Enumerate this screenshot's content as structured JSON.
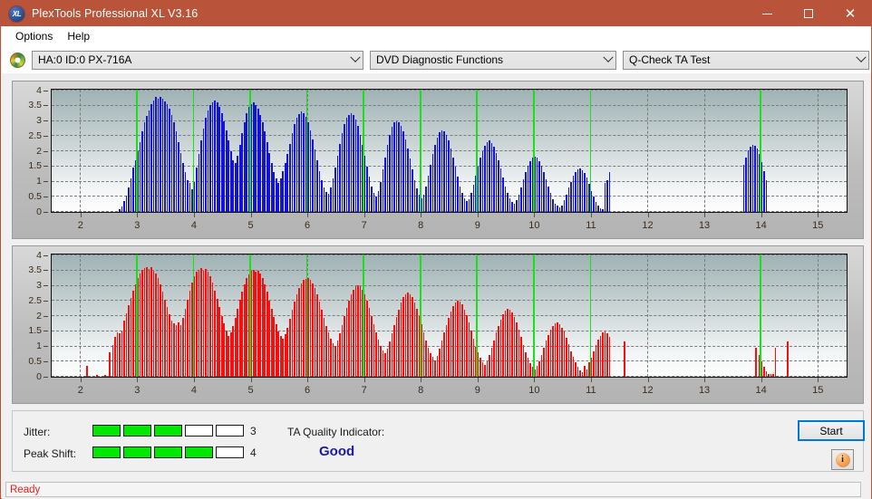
{
  "window": {
    "title": "PlexTools Professional XL V3.16",
    "app_icon": "XL",
    "minimize_label": "Minimize",
    "maximize_label": "Maximize",
    "close_label": "Close",
    "titlebar_color": "#b9543a"
  },
  "menu": {
    "items": [
      {
        "label": "Options"
      },
      {
        "label": "Help"
      }
    ]
  },
  "toolbar": {
    "device_icon": "disc-icon",
    "device": {
      "value": "HA:0 ID:0  PX-716A"
    },
    "function": {
      "value": "DVD Diagnostic Functions"
    },
    "test": {
      "value": "Q-Check TA Test"
    }
  },
  "indicators": {
    "jitter_label": "Jitter:",
    "jitter_value": "3",
    "jitter_filled": 3,
    "jitter_total": 5,
    "peak_shift_label": "Peak Shift:",
    "peak_shift_value": "4",
    "peak_shift_filled": 4,
    "peak_shift_total": 5,
    "quality_label": "TA Quality Indicator:",
    "quality_value": "Good",
    "quality_color": "#1a1aa8",
    "meter_on_color": "#00e700",
    "start_label": "Start",
    "info_icon": "info-icon",
    "info_glyph": "i"
  },
  "statusbar": {
    "text": "Ready",
    "color": "#e02020"
  },
  "chart_data": [
    {
      "id": "chart-top",
      "type": "bar",
      "title": "",
      "xlabel": "",
      "ylabel": "",
      "series_name": "Jitter / TA deviation (top)",
      "color": "#1313d8",
      "xlim": [
        1.5,
        15.5
      ],
      "ylim": [
        0,
        4
      ],
      "xticks": [
        2,
        3,
        4,
        5,
        6,
        7,
        8,
        9,
        10,
        11,
        12,
        13,
        14,
        15
      ],
      "yticks": [
        0,
        0.5,
        1,
        1.5,
        2,
        2.5,
        3,
        3.5,
        4
      ],
      "ytick_labels": [
        "0",
        "0.5",
        "1",
        "1.5",
        "2",
        "2.5",
        "3",
        "3.5",
        "4"
      ],
      "grid": true,
      "markers": [
        3,
        4,
        5,
        6,
        7,
        8,
        9,
        10,
        11,
        14
      ],
      "bar_width": 0.016,
      "x": [
        2.7,
        2.74,
        2.78,
        2.82,
        2.86,
        2.9,
        2.94,
        2.98,
        3.02,
        3.06,
        3.1,
        3.14,
        3.18,
        3.22,
        3.26,
        3.3,
        3.34,
        3.38,
        3.42,
        3.46,
        3.5,
        3.54,
        3.58,
        3.62,
        3.66,
        3.7,
        3.74,
        3.78,
        3.82,
        3.86,
        3.9,
        3.94,
        3.98,
        4.02,
        4.06,
        4.1,
        4.14,
        4.18,
        4.22,
        4.26,
        4.3,
        4.34,
        4.38,
        4.42,
        4.46,
        4.5,
        4.54,
        4.58,
        4.62,
        4.66,
        4.7,
        4.74,
        4.78,
        4.82,
        4.86,
        4.9,
        4.94,
        4.98,
        5.02,
        5.06,
        5.1,
        5.14,
        5.18,
        5.22,
        5.26,
        5.3,
        5.34,
        5.38,
        5.42,
        5.46,
        5.5,
        5.54,
        5.58,
        5.62,
        5.66,
        5.7,
        5.74,
        5.78,
        5.82,
        5.86,
        5.9,
        5.94,
        5.98,
        6.02,
        6.06,
        6.1,
        6.14,
        6.18,
        6.22,
        6.26,
        6.3,
        6.34,
        6.38,
        6.42,
        6.46,
        6.5,
        6.54,
        6.58,
        6.62,
        6.66,
        6.7,
        6.74,
        6.78,
        6.82,
        6.86,
        6.9,
        6.94,
        6.98,
        7.02,
        7.06,
        7.1,
        7.14,
        7.18,
        7.22,
        7.26,
        7.3,
        7.34,
        7.38,
        7.42,
        7.46,
        7.5,
        7.54,
        7.58,
        7.62,
        7.66,
        7.7,
        7.74,
        7.78,
        7.82,
        7.86,
        7.9,
        7.94,
        7.98,
        8.02,
        8.06,
        8.1,
        8.14,
        8.18,
        8.22,
        8.26,
        8.3,
        8.34,
        8.38,
        8.42,
        8.46,
        8.5,
        8.54,
        8.58,
        8.62,
        8.66,
        8.7,
        8.74,
        8.78,
        8.82,
        8.86,
        8.9,
        8.94,
        8.98,
        9.02,
        9.06,
        9.1,
        9.14,
        9.18,
        9.22,
        9.26,
        9.3,
        9.34,
        9.38,
        9.42,
        9.46,
        9.5,
        9.54,
        9.58,
        9.62,
        9.66,
        9.7,
        9.74,
        9.78,
        9.82,
        9.86,
        9.9,
        9.94,
        9.98,
        10.02,
        10.06,
        10.1,
        10.14,
        10.18,
        10.22,
        10.26,
        10.3,
        10.34,
        10.38,
        10.42,
        10.46,
        10.5,
        10.54,
        10.58,
        10.62,
        10.66,
        10.7,
        10.74,
        10.78,
        10.82,
        10.86,
        10.9,
        10.94,
        10.98,
        11.02,
        11.06,
        11.1,
        11.14,
        11.18,
        11.22,
        11.26,
        11.3,
        11.34,
        13.7,
        13.74,
        13.78,
        13.82,
        13.86,
        13.9,
        13.94,
        13.98,
        14.02,
        14.06,
        14.1,
        14.14,
        14.18,
        14.22
      ],
      "values": [
        0.1,
        0.18,
        0.35,
        0.55,
        0.8,
        1.1,
        1.45,
        1.7,
        2.0,
        2.3,
        2.65,
        2.95,
        3.15,
        3.35,
        3.55,
        3.68,
        3.78,
        3.72,
        3.8,
        3.72,
        3.65,
        3.55,
        3.4,
        3.2,
        2.95,
        2.65,
        2.3,
        1.95,
        1.6,
        1.3,
        1.05,
        0.95,
        0.75,
        1.0,
        1.45,
        1.9,
        2.35,
        2.75,
        3.1,
        3.35,
        3.52,
        3.62,
        3.68,
        3.6,
        3.45,
        3.25,
        3.0,
        2.7,
        2.35,
        2.0,
        1.7,
        1.6,
        1.85,
        2.2,
        2.6,
        2.95,
        3.25,
        3.45,
        3.55,
        3.6,
        3.52,
        3.4,
        3.2,
        2.95,
        2.65,
        2.3,
        1.95,
        1.6,
        1.3,
        1.1,
        0.95,
        1.1,
        1.35,
        1.6,
        1.9,
        2.25,
        2.6,
        2.9,
        3.1,
        3.22,
        3.3,
        3.25,
        3.12,
        2.95,
        2.7,
        2.4,
        2.05,
        1.7,
        1.35,
        1.05,
        0.8,
        0.65,
        0.6,
        0.8,
        1.1,
        1.45,
        1.85,
        2.25,
        2.6,
        2.9,
        3.1,
        3.2,
        3.25,
        3.18,
        3.05,
        2.85,
        2.55,
        2.2,
        1.85,
        1.5,
        1.15,
        0.85,
        0.62,
        0.5,
        0.68,
        1.0,
        1.4,
        1.8,
        2.2,
        2.55,
        2.8,
        2.95,
        3.0,
        2.95,
        2.85,
        2.65,
        2.4,
        2.1,
        1.75,
        1.4,
        1.05,
        0.78,
        0.58,
        0.45,
        0.58,
        0.85,
        1.2,
        1.55,
        1.9,
        2.2,
        2.45,
        2.62,
        2.7,
        2.65,
        2.55,
        2.35,
        2.1,
        1.8,
        1.48,
        1.15,
        0.85,
        0.62,
        0.45,
        0.35,
        0.42,
        0.62,
        0.9,
        1.2,
        1.5,
        1.78,
        2.0,
        2.18,
        2.3,
        2.35,
        2.28,
        2.15,
        1.95,
        1.7,
        1.42,
        1.12,
        0.85,
        0.62,
        0.45,
        0.32,
        0.28,
        0.38,
        0.58,
        0.82,
        1.08,
        1.32,
        1.52,
        1.68,
        1.78,
        1.82,
        1.78,
        1.68,
        1.52,
        1.32,
        1.08,
        0.85,
        0.62,
        0.42,
        0.28,
        0.2,
        0.15,
        0.22,
        0.38,
        0.58,
        0.8,
        1.0,
        1.18,
        1.32,
        1.4,
        1.42,
        1.38,
        1.28,
        1.12,
        0.92,
        0.7,
        0.5,
        0.32,
        0.2,
        0.12,
        0.08,
        0.95,
        1.05,
        1.3,
        1.55,
        1.8,
        2.02,
        2.15,
        2.2,
        2.18,
        2.08,
        1.9,
        1.65,
        1.35,
        1.05
      ]
    },
    {
      "id": "chart-bottom",
      "type": "bar",
      "title": "",
      "xlabel": "",
      "ylabel": "",
      "series_name": "Peak Shift / TA deviation (bottom)",
      "color": "#f50f0f",
      "xlim": [
        1.5,
        15.5
      ],
      "ylim": [
        0,
        4
      ],
      "xticks": [
        2,
        3,
        4,
        5,
        6,
        7,
        8,
        9,
        10,
        11,
        12,
        13,
        14,
        15
      ],
      "yticks": [
        0,
        0.5,
        1,
        1.5,
        2,
        2.5,
        3,
        3.5,
        4
      ],
      "ytick_labels": [
        "0",
        "0.5",
        "1",
        "1.5",
        "2",
        "2.5",
        "3",
        "3.5",
        "4"
      ],
      "grid": true,
      "markers": [
        3,
        4,
        5,
        6,
        7,
        8,
        9,
        10,
        11,
        14
      ],
      "bar_width": 0.022,
      "x": [
        2.12,
        2.3,
        2.44,
        2.52,
        2.58,
        2.62,
        2.66,
        2.7,
        2.74,
        2.78,
        2.82,
        2.86,
        2.9,
        2.94,
        2.98,
        3.02,
        3.06,
        3.1,
        3.14,
        3.18,
        3.22,
        3.26,
        3.3,
        3.34,
        3.38,
        3.42,
        3.46,
        3.5,
        3.54,
        3.58,
        3.62,
        3.66,
        3.7,
        3.74,
        3.78,
        3.82,
        3.86,
        3.9,
        3.94,
        3.98,
        4.02,
        4.06,
        4.1,
        4.14,
        4.18,
        4.22,
        4.26,
        4.3,
        4.34,
        4.38,
        4.42,
        4.46,
        4.5,
        4.54,
        4.58,
        4.62,
        4.66,
        4.7,
        4.74,
        4.78,
        4.82,
        4.86,
        4.9,
        4.94,
        4.98,
        5.02,
        5.06,
        5.1,
        5.14,
        5.18,
        5.22,
        5.26,
        5.3,
        5.34,
        5.38,
        5.42,
        5.46,
        5.5,
        5.54,
        5.58,
        5.62,
        5.66,
        5.7,
        5.74,
        5.78,
        5.82,
        5.86,
        5.9,
        5.94,
        5.98,
        6.02,
        6.06,
        6.1,
        6.14,
        6.18,
        6.22,
        6.26,
        6.3,
        6.34,
        6.38,
        6.42,
        6.46,
        6.5,
        6.54,
        6.58,
        6.62,
        6.66,
        6.7,
        6.74,
        6.78,
        6.82,
        6.86,
        6.9,
        6.94,
        6.98,
        7.02,
        7.06,
        7.1,
        7.14,
        7.18,
        7.22,
        7.26,
        7.3,
        7.34,
        7.38,
        7.42,
        7.46,
        7.5,
        7.54,
        7.58,
        7.62,
        7.66,
        7.7,
        7.74,
        7.78,
        7.82,
        7.86,
        7.9,
        7.94,
        7.98,
        8.02,
        8.06,
        8.1,
        8.14,
        8.18,
        8.22,
        8.26,
        8.3,
        8.34,
        8.38,
        8.42,
        8.46,
        8.5,
        8.54,
        8.58,
        8.62,
        8.66,
        8.7,
        8.74,
        8.78,
        8.82,
        8.86,
        8.9,
        8.94,
        8.98,
        9.02,
        9.06,
        9.1,
        9.14,
        9.18,
        9.22,
        9.26,
        9.3,
        9.34,
        9.38,
        9.42,
        9.46,
        9.5,
        9.54,
        9.58,
        9.62,
        9.66,
        9.7,
        9.74,
        9.78,
        9.82,
        9.86,
        9.9,
        9.94,
        9.98,
        10.02,
        10.06,
        10.1,
        10.14,
        10.18,
        10.22,
        10.26,
        10.3,
        10.34,
        10.38,
        10.42,
        10.46,
        10.5,
        10.54,
        10.58,
        10.62,
        10.66,
        10.7,
        10.74,
        10.78,
        10.82,
        10.86,
        10.9,
        10.94,
        10.98,
        11.02,
        11.06,
        11.1,
        11.14,
        11.18,
        11.22,
        11.26,
        11.3,
        11.34,
        11.6,
        13.92,
        13.98,
        14.02,
        14.06,
        14.1,
        14.14,
        14.18,
        14.22,
        14.26,
        14.48
      ],
      "values": [
        0.35,
        0.05,
        0.06,
        0.8,
        1.05,
        1.3,
        1.45,
        1.42,
        1.52,
        1.85,
        2.1,
        2.35,
        2.6,
        2.85,
        3.05,
        3.25,
        3.4,
        3.52,
        3.58,
        3.62,
        3.55,
        3.6,
        3.5,
        3.4,
        3.25,
        3.05,
        2.8,
        2.55,
        2.3,
        2.05,
        1.85,
        1.75,
        1.7,
        1.8,
        1.7,
        1.95,
        2.25,
        2.55,
        2.85,
        3.1,
        3.3,
        3.45,
        3.52,
        3.58,
        3.5,
        3.55,
        3.45,
        3.3,
        3.1,
        2.85,
        2.58,
        2.3,
        2.0,
        1.75,
        1.52,
        1.35,
        1.45,
        1.68,
        1.95,
        2.25,
        2.55,
        2.8,
        3.05,
        3.25,
        3.38,
        3.48,
        3.52,
        3.45,
        3.5,
        3.4,
        3.25,
        3.05,
        2.8,
        2.52,
        2.25,
        1.98,
        1.72,
        1.5,
        1.35,
        1.25,
        1.4,
        1.62,
        1.9,
        2.2,
        2.48,
        2.72,
        2.92,
        3.08,
        3.18,
        3.22,
        3.25,
        3.18,
        3.08,
        2.92,
        2.72,
        2.48,
        2.22,
        1.95,
        1.68,
        1.45,
        1.25,
        1.1,
        1.02,
        1.18,
        1.42,
        1.7,
        2.0,
        2.28,
        2.52,
        2.72,
        2.88,
        2.98,
        3.02,
        2.98,
        2.88,
        2.72,
        2.52,
        2.28,
        2.0,
        1.72,
        1.45,
        1.22,
        1.02,
        0.88,
        0.78,
        0.92,
        1.15,
        1.42,
        1.7,
        1.98,
        2.22,
        2.45,
        2.62,
        2.72,
        2.78,
        2.72,
        2.62,
        2.45,
        2.25,
        2.0,
        1.72,
        1.45,
        1.18,
        0.95,
        0.78,
        0.65,
        0.55,
        0.7,
        0.92,
        1.18,
        1.45,
        1.7,
        1.95,
        2.15,
        2.32,
        2.45,
        2.52,
        2.48,
        2.38,
        2.22,
        2.02,
        1.78,
        1.52,
        1.25,
        1.0,
        0.8,
        0.62,
        0.48,
        0.4,
        0.52,
        0.72,
        0.95,
        1.2,
        1.45,
        1.68,
        1.88,
        2.05,
        2.18,
        2.25,
        2.22,
        2.12,
        1.98,
        1.78,
        1.55,
        1.3,
        1.05,
        0.82,
        0.62,
        0.45,
        0.32,
        0.25,
        0.35,
        0.52,
        0.72,
        0.95,
        1.18,
        1.38,
        1.55,
        1.68,
        1.75,
        1.78,
        1.72,
        1.62,
        1.48,
        1.28,
        1.08,
        0.85,
        0.65,
        0.48,
        0.32,
        0.22,
        0.15,
        0.35,
        0.25,
        0.48,
        0.62,
        0.85,
        1.05,
        1.22,
        1.35,
        1.45,
        1.48,
        1.42,
        1.3,
        1.15,
        0.95,
        0.72,
        0.5,
        0.32,
        0.18,
        0.1,
        0.08,
        0.1,
        0.95,
        1.15,
        1.2,
        1.32,
        1.18,
        1.1,
        1.05,
        0.88,
        0.1
      ]
    }
  ]
}
